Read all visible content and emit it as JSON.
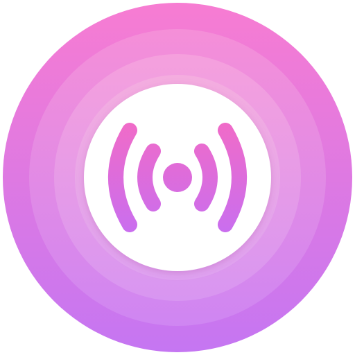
{
  "icon": {
    "name": "broadcast-signal-icon",
    "colors": {
      "outer_top": "#f77cd2",
      "outer_bottom": "#c576f2",
      "ring_2_top": "#f58fd8",
      "ring_2_bottom": "#cf86f2",
      "ring_3_top": "#f5a0dd",
      "ring_3_bottom": "#d896f1",
      "ring_4_top": "#f4addf",
      "ring_4_bottom": "#dea2f0",
      "inner_disc": "#ffffff",
      "glyph_top": "#f26bc6",
      "glyph_bottom": "#c86ef0"
    }
  }
}
